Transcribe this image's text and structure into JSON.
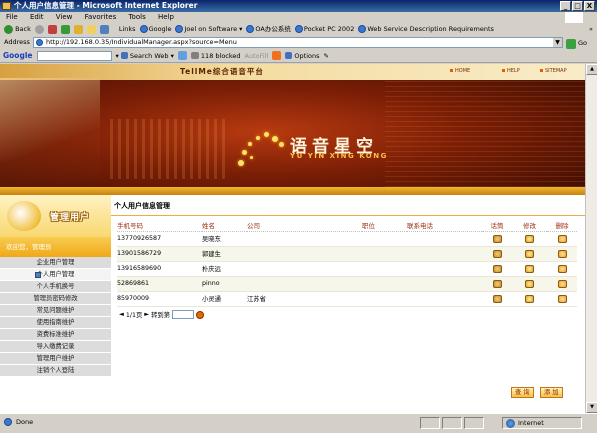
{
  "window": {
    "title": "个人用户信息管理 - Microsoft Internet Explorer",
    "minimize": "_",
    "maximize": "□",
    "close": "X"
  },
  "menu": [
    "File",
    "Edit",
    "View",
    "Favorites",
    "Tools",
    "Help"
  ],
  "toolbar": {
    "back": "Back",
    "links_label": "Links",
    "links": [
      "Google",
      "Joel on Software",
      "OA办公系统",
      "Pocket PC 2002",
      "Web Service Description Requirements"
    ],
    "more": "»"
  },
  "address": {
    "label": "Address",
    "url": "http://192.168.0.35/IndividualManager.aspx?source=Menu",
    "go": "Go"
  },
  "googlebar": {
    "logo": "Google",
    "search_web": "Search Web",
    "blocked": "118 blocked",
    "autofill": "AutoFill",
    "options": "Options"
  },
  "banner": {
    "site_title": "TellMe综合语音平台",
    "links": [
      "HOME",
      "HELP",
      "SITEMAP"
    ],
    "logo_cn": "语音星空",
    "logo_pinyin": "YU YIN XING KONG"
  },
  "sidebar": {
    "title": "管理用户",
    "welcome": "欢迎您，管理员",
    "items": [
      "企业用户管理",
      "个人用户管理",
      "个人手机换号",
      "管理员密码修改",
      "常见问题维护",
      "使用指南维护",
      "资费标准维护",
      "导入缴费记录",
      "管理用户维护",
      "注销个人登陆"
    ],
    "active_index": 1
  },
  "main": {
    "title": "个人用户信息管理",
    "columns": [
      "手机号码",
      "姓名",
      "公司",
      "职位",
      "联系电话",
      "话筒",
      "修改",
      "删除"
    ],
    "rows": [
      {
        "phone": "13770926587",
        "name": "吴晓东",
        "company": "",
        "position": "",
        "tel": ""
      },
      {
        "phone": "13901586729",
        "name": "郭建生",
        "company": "",
        "position": "",
        "tel": ""
      },
      {
        "phone": "13916589690",
        "name": "朴庆远",
        "company": "",
        "position": "",
        "tel": ""
      },
      {
        "phone": "52869861",
        "name": "pinno",
        "company": "",
        "position": "",
        "tel": ""
      },
      {
        "phone": "85970009",
        "name": "小灵通",
        "company": "江苏省",
        "position": "",
        "tel": ""
      }
    ],
    "pager": {
      "prev": "◄",
      "page_info": "1/1页",
      "next": "►",
      "goto_label": "转到第",
      "input_value": ""
    },
    "buttons": {
      "query": "查 询",
      "add": "添 加"
    }
  },
  "status": {
    "left": "Done",
    "zone": "Internet"
  }
}
